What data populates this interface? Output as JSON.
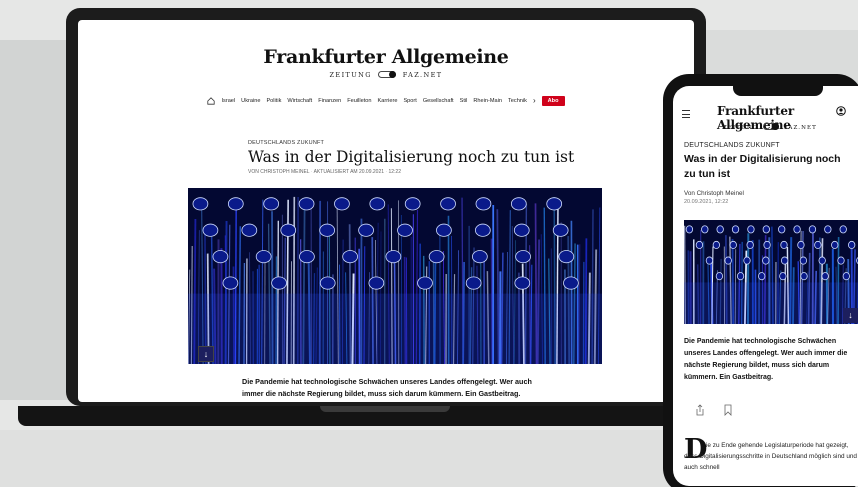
{
  "desktop": {
    "logo": "Frankfurter Allgemeine",
    "logo_sub_left": "ZEITUNG",
    "logo_sub_right": "FAZ.NET",
    "nav": {
      "items": [
        "Israel",
        "Ukraine",
        "Politik",
        "Wirtschaft",
        "Finanzen",
        "Feuilleton",
        "Karriere",
        "Sport",
        "Gesellschaft",
        "Stil",
        "Rhein-Main",
        "Technik"
      ],
      "chevron": "›",
      "abo_label": "Abo"
    },
    "article": {
      "kicker": "DEUTSCHLANDS ZUKUNFT",
      "headline": "Was in der Digitalisierung noch zu tun ist",
      "byline": "VON CHRISTOPH MEINEL",
      "separator": "·",
      "updated": "AKTUALISIERT AM 20.09.2021",
      "time": "12:22",
      "lead": "Die Pandemie hat technologische Schwächen unseres Landes offengelegt. Wer auch immer die nächste Regierung bildet, muss sich darum kümmern. Ein Gastbeitrag.",
      "download_icon": "↓"
    }
  },
  "mobile": {
    "logo": "Frankfurter Allgemeine",
    "logo_sub_left": "ZEITUNG",
    "logo_sub_right": "FAZ.NET",
    "kicker": "DEUTSCHLANDS ZUKUNFT",
    "headline": "Was in der Digitalisierung noch zu tun ist",
    "author": "Von Christoph Meinel",
    "date": "20.09.2021, 12:22",
    "lead": "Die Pandemie hat technologische Schwächen unseres Landes offengelegt. Wer auch immer die nächste Regierung bildet, muss sich darum kümmern. Ein Gastbeitrag.",
    "dropcap": "D",
    "body": "ie zu Ende gehende Legislaturperiode hat gezeigt, dass Digitalisierungsschritte in Deutschland möglich sind und auch schnell",
    "download_icon": "↓"
  },
  "colors": {
    "abo_red": "#d0021b",
    "hero_blue": "#1e3cff",
    "download_bg": "#1d1f5e"
  }
}
